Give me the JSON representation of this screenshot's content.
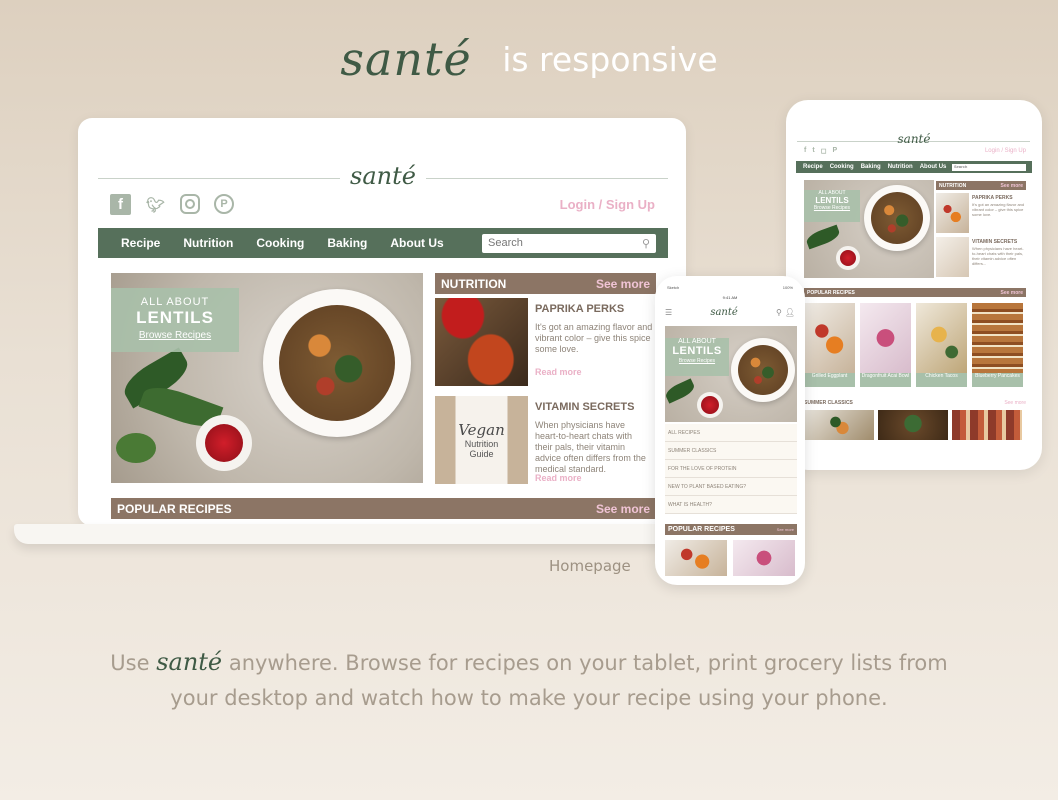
{
  "hero": {
    "logo": "santé",
    "tagline_title": "is responsive"
  },
  "laptop": {
    "logo": "santé",
    "social_icons": [
      "facebook-icon",
      "twitter-icon",
      "instagram-icon",
      "pinterest-icon"
    ],
    "login_link": "Login / Sign Up",
    "nav": [
      "Recipe",
      "Nutrition",
      "Cooking",
      "Baking",
      "About Us"
    ],
    "search_placeholder": "Search",
    "hero_card": {
      "line1": "ALL ABOUT",
      "line2": "LENTILS",
      "cta": "Browse Recipes"
    },
    "nutrition": {
      "title": "NUTRITION",
      "more": "See more",
      "articles": [
        {
          "title": "PAPRIKA PERKS",
          "text": "It's got an amazing flavor and vibrant color – give this spice some love.",
          "read": "Read more"
        },
        {
          "title": "VITAMIN SECRETS",
          "text": "When physicians have heart-to-heart chats with their pals, their vitamin advice often differs from the medical standard.",
          "read": "Read more"
        }
      ],
      "guide_label1": "Vegan",
      "guide_label2": "Nutrition Guide"
    },
    "popular": {
      "title": "POPULAR RECIPES",
      "more": "See more"
    }
  },
  "caption": "Homepage",
  "tablet": {
    "logo": "santé",
    "login_link": "Login / Sign Up",
    "nav": [
      "Recipe",
      "Cooking",
      "Baking",
      "Nutrition",
      "About Us"
    ],
    "search_placeholder": "Search",
    "hero_card": {
      "line1": "ALL ABOUT",
      "line2": "LENTILS",
      "cta": "Browse Recipes"
    },
    "nutrition": {
      "title": "NUTRITION",
      "more": "See more",
      "articles": [
        {
          "title": "PAPRIKA PERKS",
          "text": "It's got an amazing flavor and vibrant color – give this spice some love.",
          "read": "Read more"
        },
        {
          "title": "VITAMIN SECRETS",
          "text": "When physicians have heart-to-heart chats with their pals, their vitamin advice often differs...",
          "read": "Read more"
        }
      ]
    },
    "popular": {
      "title": "POPULAR RECIPES",
      "more": "See more",
      "cards": [
        "Grilled Eggplant",
        "Dragonfruit Acai Bowl",
        "Chicken Tacos",
        "Blueberry Pancakes"
      ]
    },
    "summer": {
      "title": "SUMMER CLASSICS",
      "more": "See more"
    }
  },
  "phone": {
    "carrier": "Sketch",
    "time": "9:41 AM",
    "battery": "100%",
    "logo": "santé",
    "hero_card": {
      "line1": "ALL ABOUT",
      "line2": "LENTILS",
      "cta": "Browse Recipes"
    },
    "menu": [
      "ALL RECIPES",
      "SUMMER CLASSICS",
      "FOR THE LOVE OF PROTEIN",
      "NEW TO PLANT BASED EATING?",
      "WHAT IS HEALTH?"
    ],
    "popular": {
      "title": "POPULAR RECIPES",
      "more": "See more"
    }
  },
  "tagline": {
    "before": "Use",
    "logo": "santé",
    "after": "anywhere. Browse for recipes on your tablet, print grocery lists from your desktop and watch how to make your recipe using your phone."
  }
}
